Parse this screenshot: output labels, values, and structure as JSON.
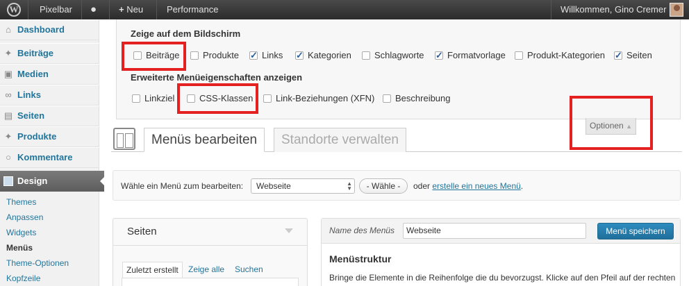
{
  "adminbar": {
    "site_name": "Pixelbar",
    "new_label": "Neu",
    "performance_label": "Performance",
    "greeting": "Willkommen, Gino Cremer"
  },
  "sidebar": {
    "items": [
      {
        "label": "Dashboard",
        "icon": "home-icon"
      },
      {
        "label": "Beiträge",
        "icon": "pin-icon"
      },
      {
        "label": "Medien",
        "icon": "media-icon"
      },
      {
        "label": "Links",
        "icon": "link-icon"
      },
      {
        "label": "Seiten",
        "icon": "page-icon"
      },
      {
        "label": "Produkte",
        "icon": "pin-icon"
      },
      {
        "label": "Kommentare",
        "icon": "comment-icon"
      }
    ],
    "design_label": "Design",
    "submenu": [
      "Themes",
      "Anpassen",
      "Widgets",
      "Menüs",
      "Theme-Optionen",
      "Kopfzeile"
    ],
    "current_submenu": "Menüs"
  },
  "screen_options": {
    "heading1": "Zeige auf dem Bildschirm",
    "boxes1": [
      {
        "label": "Beiträge",
        "checked": false
      },
      {
        "label": "Produkte",
        "checked": false
      },
      {
        "label": "Links",
        "checked": true
      },
      {
        "label": "Kategorien",
        "checked": true
      },
      {
        "label": "Schlagworte",
        "checked": false
      },
      {
        "label": "Formatvorlage",
        "checked": true
      },
      {
        "label": "Produkt-Kategorien",
        "checked": false
      },
      {
        "label": "Seiten",
        "checked": true
      }
    ],
    "heading2": "Erweiterte Menüeigenschaften anzeigen",
    "boxes2": [
      {
        "label": "Linkziel",
        "checked": false
      },
      {
        "label": "CSS-Klassen",
        "checked": false
      },
      {
        "label": "Link-Beziehungen (XFN)",
        "checked": false
      },
      {
        "label": "Beschreibung",
        "checked": false
      }
    ],
    "options_tab": "Optionen"
  },
  "tabs": {
    "edit": "Menüs bearbeiten",
    "locations": "Standorte verwalten"
  },
  "menu_select": {
    "label": "Wähle ein Menü zum bearbeiten:",
    "value": "Webseite",
    "button": "- Wähle -",
    "or": "oder",
    "create_link": "erstelle ein neues Menü"
  },
  "metabox": {
    "title": "Seiten",
    "tab_recent": "Zuletzt erstellt",
    "tab_all": "Zeige alle",
    "tab_search": "Suchen"
  },
  "management": {
    "name_label": "Name des Menüs",
    "name_value": "Webseite",
    "save": "Menü speichern",
    "structure_title": "Menüstruktur",
    "structure_text": "Bringe die Elemente in die Reihenfolge die du bevorzugst. Klicke auf den Pfeil auf der rechten Seite, um weitere Konfigurationsoptionen anzuzeigen."
  },
  "colors": {
    "highlight": "#e42020",
    "link": "#21759b",
    "primary_button": "#2e8cbf"
  }
}
